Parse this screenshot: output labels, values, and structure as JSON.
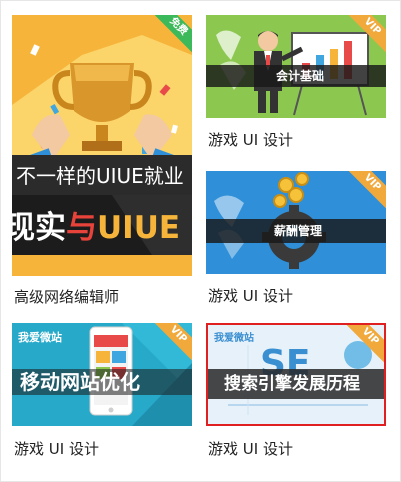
{
  "cards": [
    {
      "caption": "高级网络编辑师",
      "badge": "免费",
      "line1": "不一样的UIUE就业",
      "line2_a": "现实",
      "line2_b": "与",
      "line2_c": "UIUE"
    },
    {
      "caption": "游戏 UI 设计",
      "badge": "VIP",
      "band": "会计基础"
    },
    {
      "caption": "游戏 UI 设计",
      "badge": "VIP",
      "band": "薪酬管理"
    },
    {
      "caption": "游戏 UI 设计",
      "badge": "VIP",
      "band": "移动网站优化",
      "logo": "我爱微站"
    },
    {
      "caption": "游戏 UI 设计",
      "badge": "VIP",
      "band": "搜索引擎发展历程",
      "seo": "SE",
      "logo": "我爱微站"
    }
  ],
  "colors": {
    "free_badge": "#3cb95a",
    "vip_badge": "#f2a93b",
    "selected_border": "#e02020",
    "card1_bg": "#f6b53a",
    "card2_bg": "#8cc850",
    "card3_bg": "#2f8fd8",
    "card4_bg": "#27a9c9",
    "card5_bg": "#e7f1fa"
  }
}
